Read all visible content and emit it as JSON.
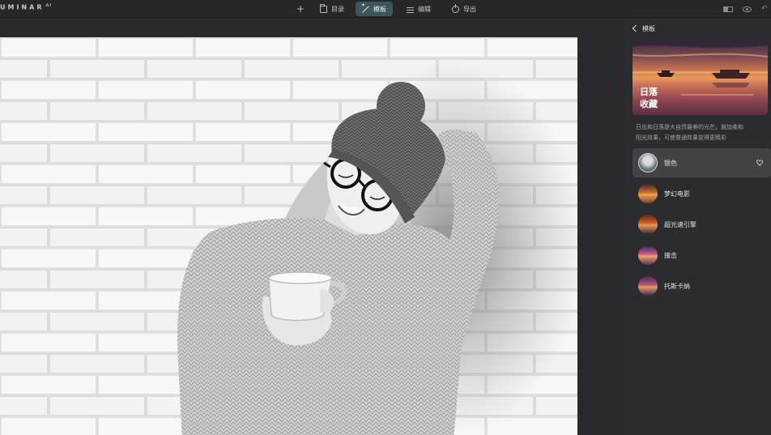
{
  "app": {
    "brand": "UMINAR",
    "brand_suffix": "AI"
  },
  "topbar": {
    "add_label": "+",
    "tabs": [
      {
        "label": "目录",
        "icon": "folder-icon",
        "active": false
      },
      {
        "label": "模板",
        "icon": "magic-wand-icon",
        "active": true
      },
      {
        "label": "编辑",
        "icon": "sliders-icon",
        "active": false
      },
      {
        "label": "导出",
        "icon": "export-icon",
        "active": false
      }
    ],
    "right_icons": [
      "compare-icon",
      "eye-icon",
      "undo-icon"
    ]
  },
  "canvas": {
    "image_description_icon": "photo"
  },
  "panel": {
    "back_label": "模板",
    "hero_title_line1": "日落",
    "hero_title_line2": "收藏",
    "description_line1": "日出和日落是大自然最美的光芒。施加柔和",
    "description_line2": "阳光效果，可使普通效果变得更精彩",
    "presets": [
      {
        "label": "银色",
        "selected": true,
        "thumb": "silver"
      },
      {
        "label": "梦幻电影",
        "selected": false,
        "thumb": "dream"
      },
      {
        "label": "超光速引擎",
        "selected": false,
        "thumb": "warp"
      },
      {
        "label": "撞击",
        "selected": false,
        "thumb": "hit"
      },
      {
        "label": "托斯卡纳",
        "selected": false,
        "thumb": "tosca"
      }
    ]
  },
  "colors": {
    "active_tab": "#3e5659",
    "panel_bg": "#2c2c2e",
    "app_bg": "#2a2a2c"
  }
}
